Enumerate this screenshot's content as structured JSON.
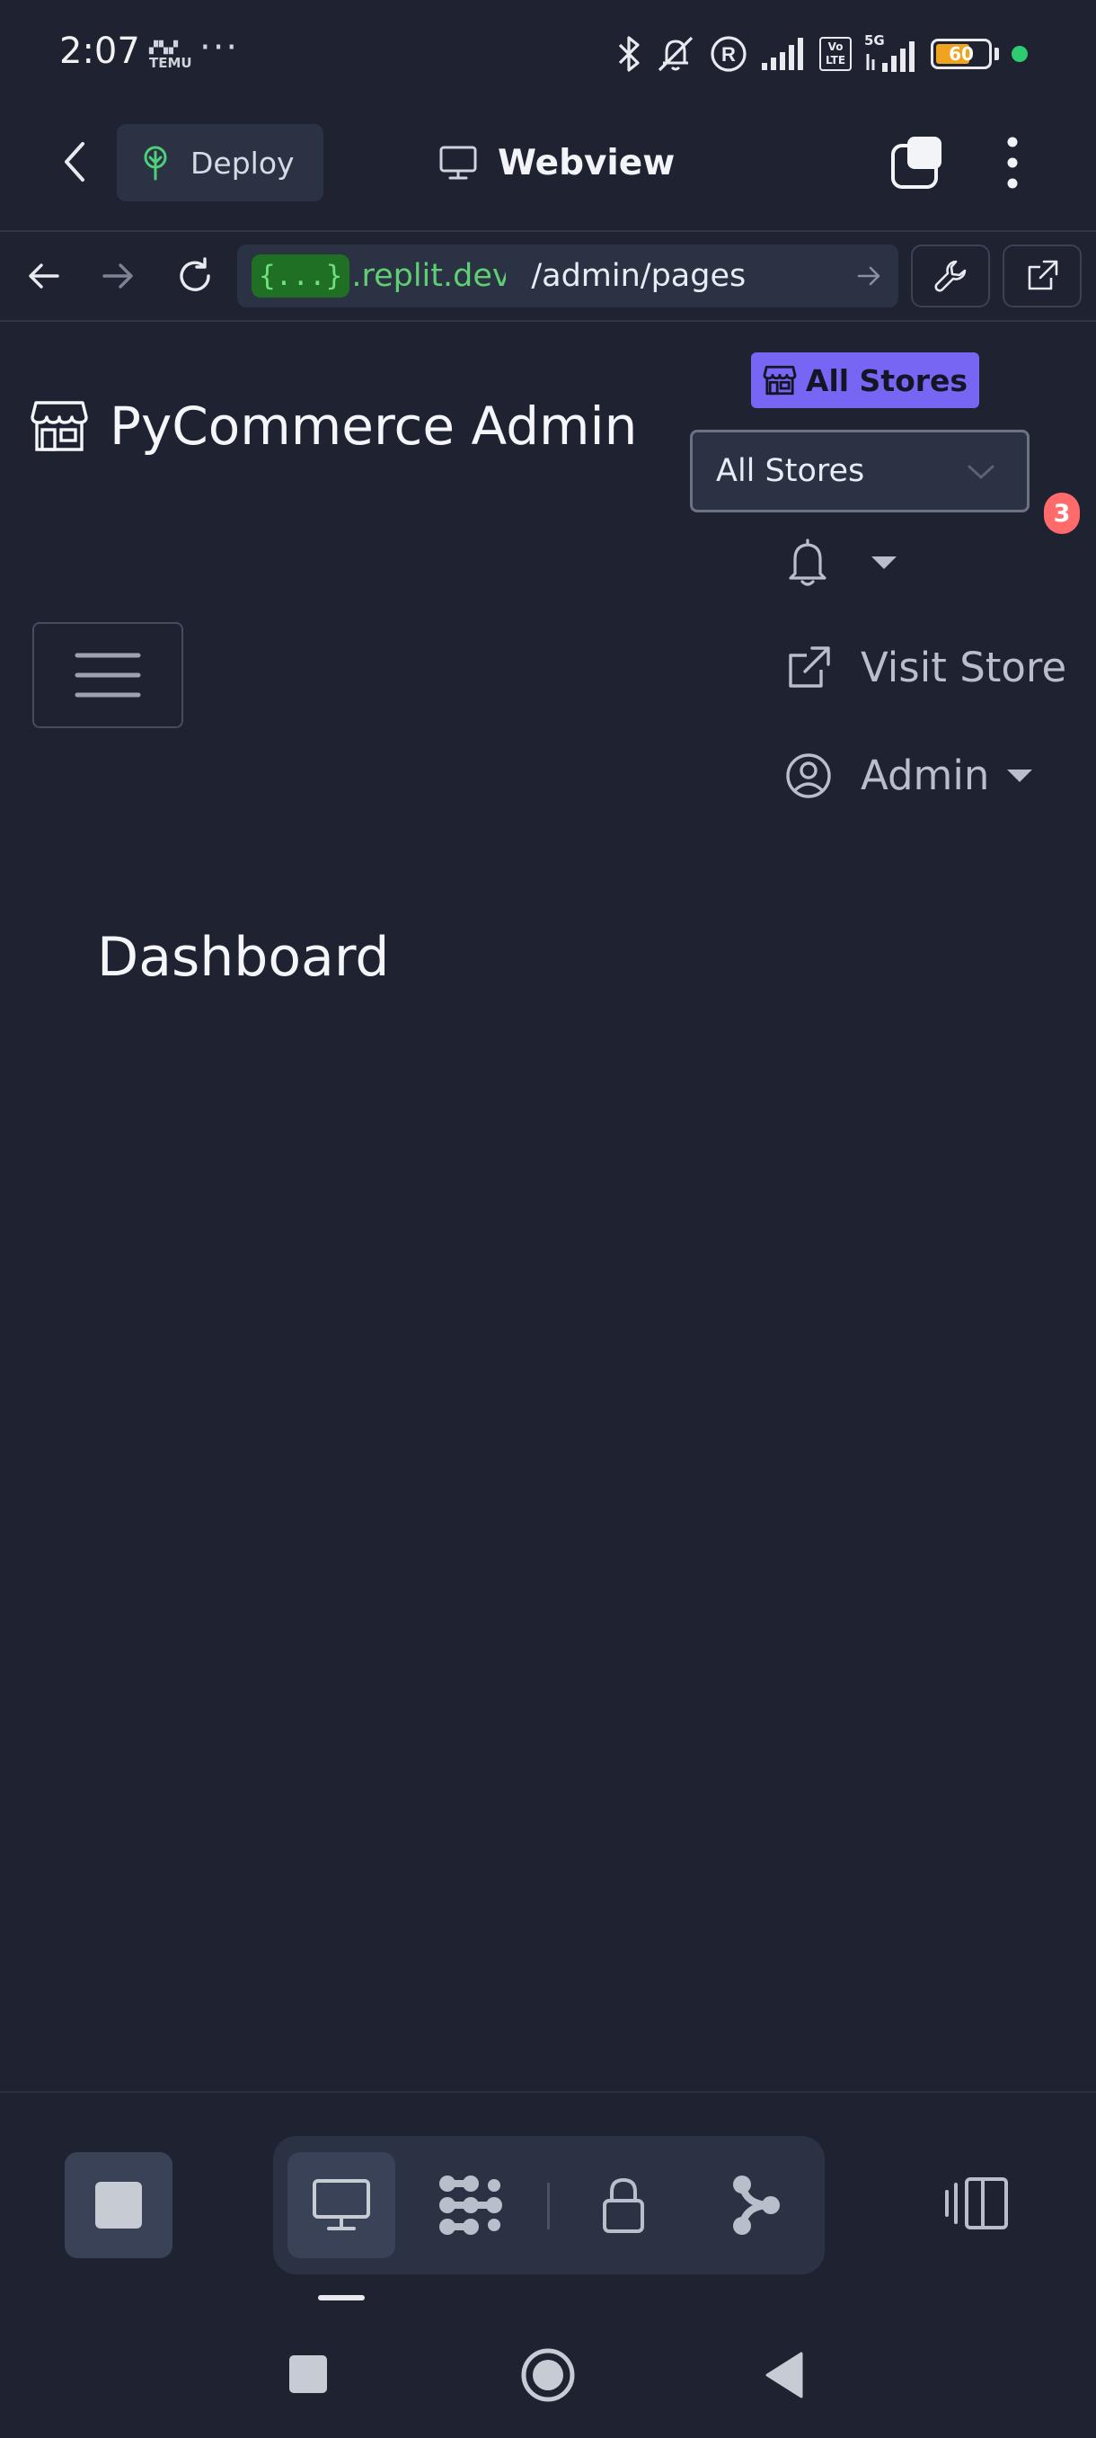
{
  "status_bar": {
    "time": "2:07",
    "temu_label": "TEMU",
    "dots": "···",
    "network_label": "5G",
    "volte_label": "Vo LTE",
    "battery_level": "60"
  },
  "topbar": {
    "deploy_label": "Deploy",
    "title": "Webview"
  },
  "urlbar": {
    "chip": "{...}",
    "host": ".replit.dev",
    "path": "/admin/pages"
  },
  "page": {
    "brand_name": "PyCommerce Admin",
    "store_badge_label": "All Stores",
    "store_select_value": "All Stores",
    "notification_count": "3",
    "visit_store_label": "Visit Store",
    "user_menu_label": "Admin",
    "heading": "Dashboard"
  },
  "colors": {
    "background": "#1e2231",
    "accent_purple": "#7766f4",
    "badge_red": "#ff6b6b",
    "url_green": "#5fcf74"
  },
  "icons": {
    "back": "chevron-left-icon",
    "deploy": "deploy-tree-icon",
    "webview": "monitor-icon",
    "tabs": "tabs-icon",
    "menu": "kebab-icon",
    "store": "storefront-icon",
    "bell": "bell-icon",
    "external": "external-link-icon",
    "user": "user-circle-icon"
  }
}
